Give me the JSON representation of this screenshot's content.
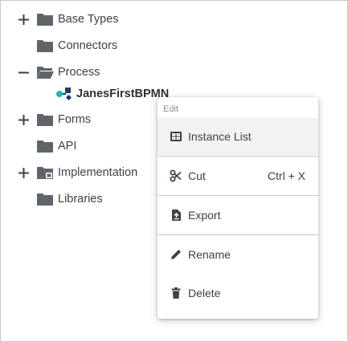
{
  "tree": {
    "items": [
      {
        "label": "Base Types",
        "toggle": "plus",
        "icon": "folder-icon"
      },
      {
        "label": "Connectors",
        "toggle": "",
        "icon": "folder-icon"
      },
      {
        "label": "Process",
        "toggle": "minus",
        "icon": "folder-open-icon"
      },
      {
        "label": "JanesFirstBPMN",
        "toggle": "",
        "icon": "bpmn-process-icon"
      },
      {
        "label": "Forms",
        "toggle": "plus",
        "icon": "folder-icon"
      },
      {
        "label": "API",
        "toggle": "",
        "icon": "folder-icon"
      },
      {
        "label": "Implementation",
        "toggle": "plus",
        "icon": "folder-special-icon"
      },
      {
        "label": "Libraries",
        "toggle": "",
        "icon": "folder-icon"
      }
    ]
  },
  "context_menu": {
    "header": "Edit",
    "items": [
      {
        "label": "Instance List",
        "icon": "table-icon",
        "shortcut": ""
      },
      {
        "label": "Cut",
        "icon": "scissors-icon",
        "shortcut": "Ctrl + X"
      },
      {
        "label": "Export",
        "icon": "export-file-icon",
        "shortcut": ""
      },
      {
        "label": "Rename",
        "icon": "pencil-icon",
        "shortcut": ""
      },
      {
        "label": "Delete",
        "icon": "trash-icon",
        "shortcut": ""
      }
    ]
  },
  "colors": {
    "icon": "#5f656b",
    "text": "#3c4248",
    "bpmn_teal": "#20b6b0",
    "bpmn_navy": "#1d3b6e"
  }
}
